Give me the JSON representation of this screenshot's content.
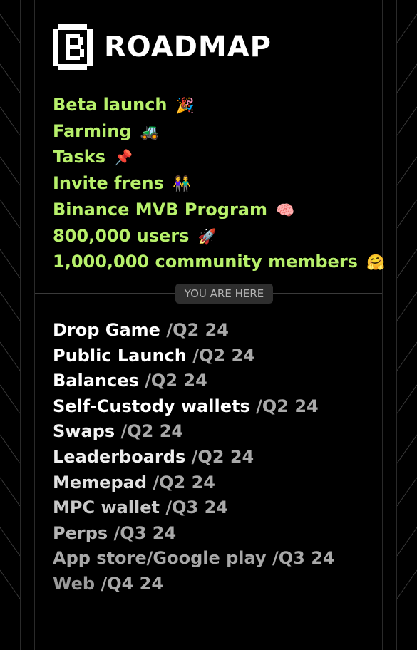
{
  "header": {
    "title": "ROADMAP",
    "logo_icon": "bracket-b-logo-icon"
  },
  "completed": [
    {
      "label": "Beta launch",
      "emoji": "🎉"
    },
    {
      "label": "Farming",
      "emoji": "🚜"
    },
    {
      "label": "Tasks",
      "emoji": "📌"
    },
    {
      "label": "Invite frens",
      "emoji": "👫"
    },
    {
      "label": "Binance MVB Program",
      "emoji": "🧠"
    },
    {
      "label": "800,000 users",
      "emoji": "🚀"
    },
    {
      "label": "1,000,000 community members",
      "emoji": "🤗"
    }
  ],
  "marker": {
    "label": "YOU ARE HERE"
  },
  "upcoming": [
    {
      "name": "Drop Game",
      "when": "/Q2 24",
      "color": "#ffffff"
    },
    {
      "name": "Public Launch",
      "when": "/Q2 24",
      "color": "#ffffff"
    },
    {
      "name": "Balances",
      "when": "/Q2 24",
      "color": "#ffffff"
    },
    {
      "name": "Self-Custody wallets",
      "when": "/Q2 24",
      "color": "#ffffff"
    },
    {
      "name": "Swaps",
      "when": "/Q2 24",
      "color": "#f2f2f2"
    },
    {
      "name": "Leaderboards",
      "when": "/Q2 24",
      "color": "#eeeeee"
    },
    {
      "name": "Memepad ",
      "when": "/Q2 24",
      "color": "#e2e2e2"
    },
    {
      "name": "MPC wallet",
      "when": "/Q3 24",
      "color": "#c8c8c8"
    },
    {
      "name": "Perps",
      "when": "/Q3 24",
      "color": "#b4b4b4"
    },
    {
      "name": "App store/Google play",
      "when": "/Q3 24",
      "color": "#a8a8a8"
    },
    {
      "name": "Web",
      "when": "/Q4 24",
      "color": "#9a9a9a"
    }
  ],
  "colors": {
    "background": "#000000",
    "accent_green": "#b7f06b",
    "badge_bg": "#2e2e2e",
    "date_gray": "#a9a9a9"
  }
}
